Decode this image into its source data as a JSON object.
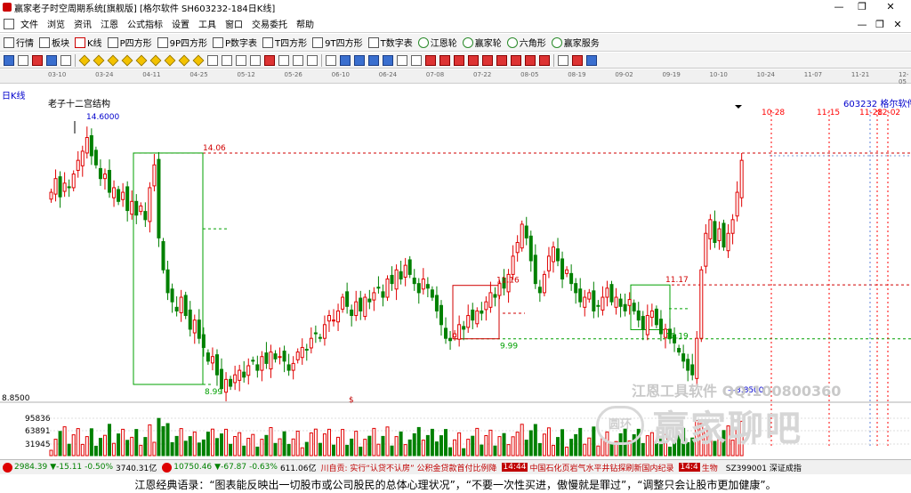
{
  "window": {
    "title": "赢家老子时空周期系统[旗舰版] [格尔软件  SH603232-184日K线]",
    "minimize": "—",
    "maximize": "❐",
    "close": "✕"
  },
  "menu": [
    "文件",
    "浏览",
    "资讯",
    "江恩",
    "公式指标",
    "设置",
    "工具",
    "窗口",
    "交易委托",
    "帮助"
  ],
  "menu_right": [
    "—",
    "❐",
    "✕"
  ],
  "toolbar1": [
    {
      "label": "行情",
      "icon": "grid-icon"
    },
    {
      "label": "板块",
      "icon": "grid-icon"
    },
    {
      "label": "K线",
      "icon": "candle-icon"
    },
    {
      "label": "P四方形",
      "icon": "p-square-icon"
    },
    {
      "label": "9P四方形",
      "icon": "p-square-icon"
    },
    {
      "label": "P数字表",
      "icon": "p-square-icon"
    },
    {
      "label": "T四方形",
      "icon": "t-square-icon"
    },
    {
      "label": "9T四方形",
      "icon": "t-square-icon"
    },
    {
      "label": "T数字表",
      "icon": "t-square-icon"
    },
    {
      "label": "江恩轮",
      "icon": "wheel-icon"
    },
    {
      "label": "赢家轮",
      "icon": "wheel-icon"
    },
    {
      "label": "六角形",
      "icon": "hexagon-icon"
    },
    {
      "label": "赢家服务",
      "icon": "dollar-icon"
    }
  ],
  "toolbar2_icons": [
    "b",
    "n",
    "r",
    "b",
    "n",
    "y",
    "y",
    "y",
    "y",
    "y",
    "y",
    "y",
    "y",
    "y",
    "n",
    "n",
    "n",
    "n",
    "r",
    "n",
    "n",
    "n",
    "n",
    "b",
    "b",
    "b",
    "b",
    "n",
    "n",
    "r",
    "r",
    "r",
    "r",
    "r",
    "r",
    "r",
    "r",
    "r",
    "n",
    "r",
    "b"
  ],
  "time_axis": [
    "03-10",
    "03-24",
    "04-11",
    "04-25",
    "05-12",
    "05-26",
    "06-10",
    "06-24",
    "07-08",
    "07-22",
    "08-05",
    "08-19",
    "09-02",
    "09-19",
    "10-10",
    "10-24",
    "11-07",
    "11-21",
    "12-05"
  ],
  "period_label": "日K线",
  "chart_title": "老子十二宫结构",
  "stock_code": "603232  格尔软件",
  "colors": {
    "up": "#e00000",
    "down": "#008000",
    "box_green": "#00a000",
    "box_red": "#d00000",
    "date_line": "#ff0000",
    "blue_line": "#5b7fd8",
    "price_grid": "#9a9a9a"
  },
  "annotations": {
    "high_label": "14.6000",
    "low_label": "8.8500",
    "level_1406": "14.06",
    "level_899": "8.99",
    "level_1116": "11.16",
    "level_999": "9.99",
    "level_1117": "11.17",
    "level_1019": "10.19",
    "dollar_mark": "$",
    "date_labels": [
      "10-28",
      "11-15",
      "11-28",
      "12-02"
    ]
  },
  "y_axis": {
    "price_label": "8.8500",
    "volume_ticks": [
      "95836",
      "63891",
      "31945"
    ]
  },
  "watermarks": {
    "line1": "江恩工具软件  QQ:100800360",
    "logo": "圆环",
    "line2": "赢家聊吧"
  },
  "statusbar": {
    "sh_index": "2984.39",
    "sh_change": "▼-15.11",
    "sh_pct": "-0.50%",
    "sh_amount": "3740.31亿",
    "sz_index": "10750.46",
    "sz_change": "▼-67.87",
    "sz_pct": "-0.63%",
    "sz_amount": "611.06亿",
    "ticker": "川自贡: 实行“认贷不认房”  公积金贷款首付比例降",
    "time1": "14:44",
    "ticker2": "中国石化页岩气水平井钻探刷新国内纪录",
    "time2": "14:4",
    "ticker3": "生物",
    "code_right": "SZ399001 深证成指"
  },
  "quote": "江恩经典语录：“图表能反映出一切股市或公司股民的总体心理状况”，“不要一次性买进，傲慢就是罪过”，“调整只会让股市更加健康”。",
  "chart_data": {
    "type": "candlestick",
    "title": "老子十二宫结构",
    "series_name": "SH603232",
    "x_ticks": [
      "03-10",
      "03-24",
      "04-11",
      "04-25",
      "05-12",
      "05-26",
      "06-10",
      "06-24",
      "07-08",
      "07-22",
      "08-05",
      "08-19",
      "09-02",
      "09-19",
      "10-10",
      "10-24",
      "11-07",
      "11-21",
      "12-05"
    ],
    "price_range": [
      8.6,
      14.8
    ],
    "high": 14.6,
    "low": 8.85,
    "levels": [
      14.06,
      11.17,
      11.16,
      10.19,
      9.99,
      8.99
    ],
    "date_markers": [
      "10-28",
      "11-15",
      "11-28",
      "12-02"
    ],
    "close": [
      13.2,
      13.5,
      13.1,
      13.4,
      13.3,
      13.6,
      13.9,
      14.1,
      14.4,
      14.0,
      13.8,
      13.5,
      13.6,
      13.2,
      13.3,
      13.0,
      13.2,
      12.8,
      13.0,
      12.7,
      12.9,
      12.6,
      13.3,
      13.8,
      12.2,
      11.5,
      11.0,
      10.8,
      10.6,
      10.9,
      10.5,
      10.2,
      10.4,
      10.0,
      9.8,
      9.5,
      9.6,
      9.2,
      8.9,
      9.1,
      8.95,
      9.2,
      9.3,
      9.15,
      9.4,
      9.5,
      9.3,
      9.6,
      9.45,
      9.7,
      9.55,
      9.6,
      9.5,
      9.3,
      9.45,
      9.7,
      9.8,
      9.75,
      10.0,
      10.1,
      10.0,
      10.3,
      10.5,
      10.4,
      10.6,
      10.9,
      10.7,
      10.5,
      10.8,
      10.6,
      10.9,
      10.8,
      11.0,
      11.1,
      10.9,
      11.3,
      11.2,
      11.5,
      11.3,
      11.6,
      11.4,
      11.2,
      11.0,
      11.3,
      11.1,
      10.9,
      10.6,
      10.3,
      10.0,
      9.95,
      10.1,
      10.3,
      10.2,
      10.5,
      10.4,
      10.6,
      10.55,
      10.8,
      11.0,
      10.9,
      11.2,
      11.1,
      11.4,
      11.8,
      12.1,
      12.5,
      12.2,
      11.7,
      11.2,
      11.0,
      11.4,
      11.8,
      12.0,
      11.7,
      11.3,
      11.5,
      11.2,
      11.0,
      10.8,
      10.9,
      11.0,
      10.6,
      10.7,
      10.9,
      11.1,
      10.8,
      10.9,
      10.7,
      10.6,
      10.85,
      10.6,
      10.4,
      10.2,
      10.5,
      10.6,
      10.3,
      10.1,
      10.2,
      10.0,
      9.9,
      9.7,
      9.5,
      9.3,
      9.2,
      10.0,
      11.5,
      12.3,
      12.6,
      12.1,
      12.4,
      12.0,
      12.3,
      12.6,
      13.2,
      13.9
    ],
    "volume_ticks": [
      95836,
      63891,
      31945
    ]
  }
}
